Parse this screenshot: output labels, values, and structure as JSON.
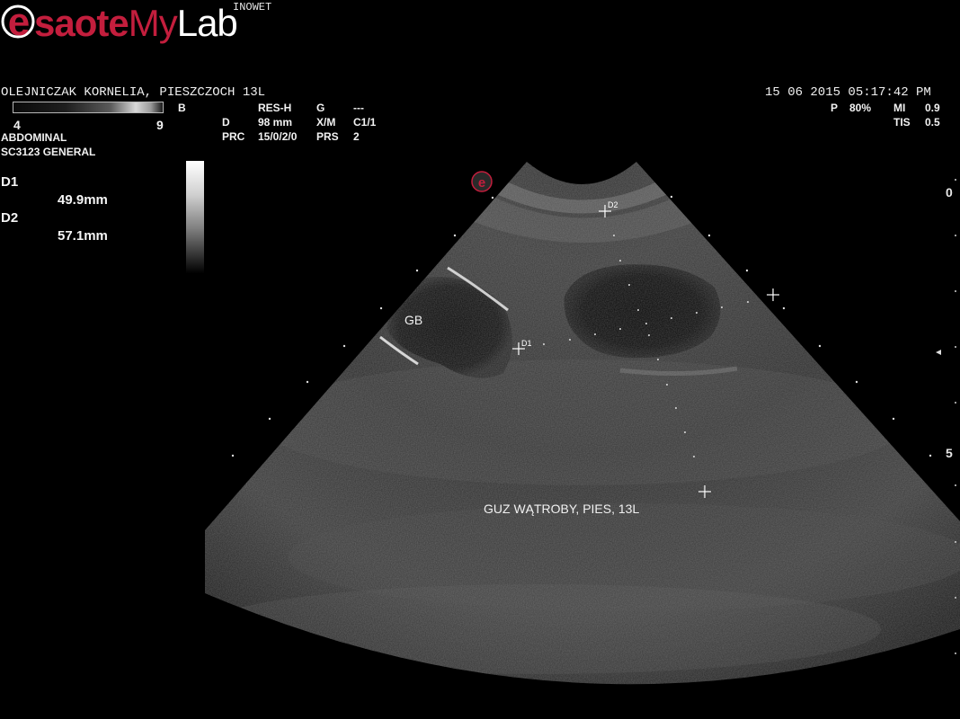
{
  "brand": {
    "logo_saote": "saote",
    "logo_my": "My",
    "logo_lab": "Lab",
    "station": "INOWET",
    "accent_color": "#c31e3d"
  },
  "patient": {
    "name_line": "OLEJNICZAK KORNELIA, PIESZCZOCH 13L",
    "date_time": "15  06  2015 05:17:42 PM"
  },
  "grayscale_bar": {
    "min_label": "4",
    "max_label": "9",
    "mode": "B"
  },
  "params_left": {
    "app": "ABDOMINAL",
    "probe": "SC3123  GENERAL"
  },
  "params_center": {
    "row1": [
      "RES-H",
      "G",
      "---"
    ],
    "row2": [
      "D",
      "98 mm",
      "X/M",
      "C1/1"
    ],
    "row3": [
      "PRC",
      "15/0/2/0",
      "PRS",
      "2"
    ]
  },
  "params_right": {
    "p_label": "P",
    "p_value": "80%",
    "mi_label": "MI",
    "mi_value": "0.9",
    "tis_label": "TIS",
    "tis_value": "0.5"
  },
  "measurements": [
    {
      "label": "D1",
      "value": "49.9mm"
    },
    {
      "label": "D2",
      "value": "57.1mm"
    }
  ],
  "annotations": {
    "gb": "GB",
    "caption": "GUZ WĄTROBY, PIES, 13L",
    "d1_marker": "D1",
    "d2_marker": "D2"
  },
  "depth_scale": {
    "top": "0",
    "mid": "5"
  }
}
